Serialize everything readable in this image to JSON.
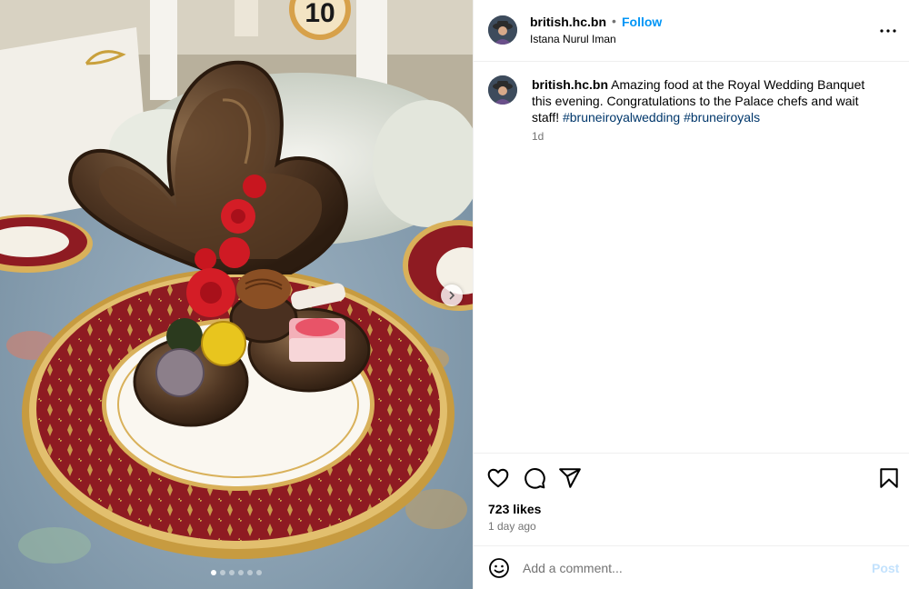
{
  "post": {
    "username": "british.hc.bn",
    "separator": "•",
    "follow_label": "Follow",
    "location": "Istana Nurul Iman",
    "more_icon": "more-horizontal-icon"
  },
  "caption": {
    "username": "british.hc.bn",
    "text": "Amazing food at the Royal Wedding Banquet this evening. Congratulations to the Palace chefs and wait staff!",
    "hashtags": [
      "#bruneiroyalwedding",
      "#bruneiroyals"
    ],
    "time": "1d"
  },
  "media": {
    "table_number": "10",
    "carousel_count": 6,
    "carousel_active": 1,
    "next_icon": "chevron-right-icon"
  },
  "actions": {
    "like_icon": "heart-icon",
    "comment_icon": "comment-icon",
    "share_icon": "share-icon",
    "save_icon": "bookmark-icon"
  },
  "stats": {
    "likes": "723 likes",
    "posted": "1 day ago"
  },
  "comment": {
    "placeholder": "Add a comment...",
    "post_label": "Post",
    "emoji_icon": "emoji-icon"
  },
  "colors": {
    "accent": "#0095f6",
    "hashtag": "#00376b",
    "post_disabled": "#c3e2fd",
    "muted": "#737373",
    "divider": "#efefef"
  }
}
